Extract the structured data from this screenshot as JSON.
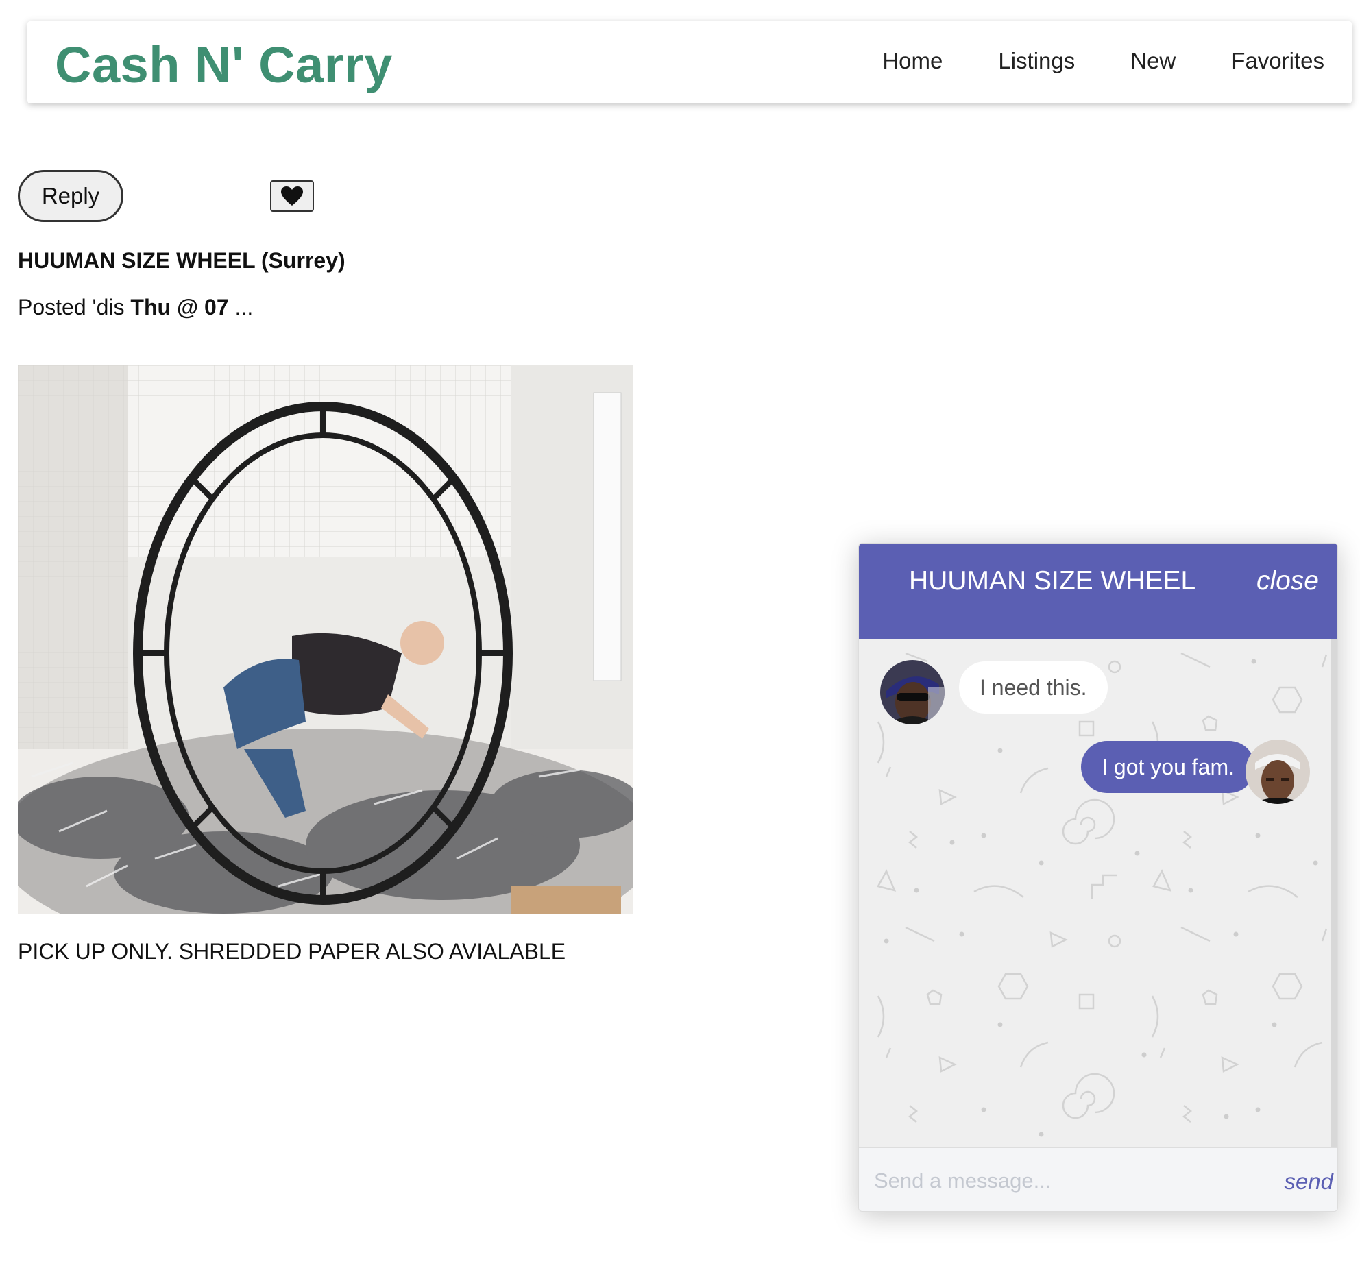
{
  "header": {
    "brand": "Cash N' Carry",
    "nav": [
      "Home",
      "Listings",
      "New",
      "Favorites"
    ]
  },
  "listing": {
    "reply_label": "Reply",
    "favorite_icon": "heart-icon",
    "title": "HUUMAN SIZE WHEEL (Surrey)",
    "posted_prefix": "Posted 'dis",
    "posted_time": "Thu @ 07",
    "posted_suffix": "...",
    "description": "PICK UP ONLY. SHREDDED PAPER ALSO AVIALABLE"
  },
  "chat": {
    "title": "HUUMAN SIZE WHEEL",
    "close_label": "close",
    "messages": [
      {
        "direction": "incoming",
        "text": "I need this."
      },
      {
        "direction": "outgoing",
        "text": "I got you fam."
      }
    ],
    "input_placeholder": "Send a message...",
    "send_label": "send"
  },
  "colors": {
    "brand": "#3f8f72",
    "chat_accent": "#5b5fb3",
    "chat_background": "#efefef"
  }
}
